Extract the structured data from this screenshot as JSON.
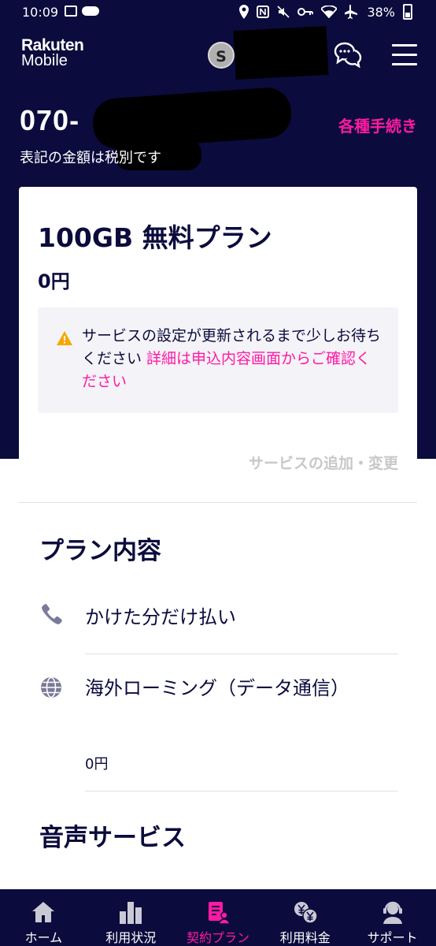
{
  "status_bar": {
    "time": "10:09",
    "battery": "38%"
  },
  "header": {
    "logo_line1": "Rakuten",
    "logo_line2": "Mobile",
    "badge": "S",
    "phone_number": "070-",
    "procedures_link": "各種手続き",
    "tax_note": "表記の金額は税別です"
  },
  "plan": {
    "name": "100GB 無料プラン",
    "price": "0円",
    "notice_text": "サービスの設定が更新されるまで少しお待ちください ",
    "notice_link": "詳細は申込内容画面からご確認ください",
    "add_service": "サービスの追加・変更"
  },
  "plan_details": {
    "title": "プラン内容",
    "items": [
      {
        "label": "かけた分だけ払い",
        "icon": "phone-icon"
      },
      {
        "label": "海外ローミング（データ通信）",
        "sub": "0円",
        "icon": "globe-icon"
      }
    ]
  },
  "voice_services": {
    "title": "音声サービス"
  },
  "bottom_nav": {
    "items": [
      {
        "label": "ホーム",
        "icon": "home-icon"
      },
      {
        "label": "利用状況",
        "icon": "bar-chart-icon"
      },
      {
        "label": "契約プラン",
        "icon": "contract-icon",
        "active": true
      },
      {
        "label": "利用料金",
        "icon": "yen-icon"
      },
      {
        "label": "サポート",
        "icon": "support-icon"
      }
    ]
  },
  "colors": {
    "navy": "#0b0b3d",
    "accent_pink": "#ff1aa3"
  }
}
